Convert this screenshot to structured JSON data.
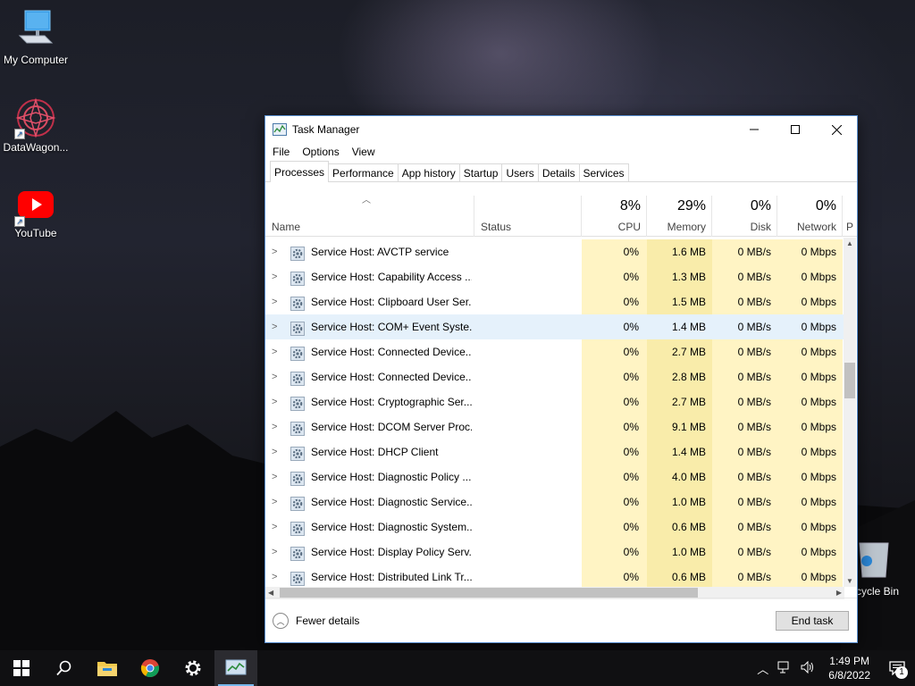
{
  "desktop": {
    "icons": [
      {
        "label": "My Computer"
      },
      {
        "label": "DataWagon..."
      },
      {
        "label": "YouTube"
      },
      {
        "label": "cycle Bin"
      }
    ]
  },
  "window": {
    "title": "Task Manager",
    "menu": [
      "File",
      "Options",
      "View"
    ],
    "tabs": [
      "Processes",
      "Performance",
      "App history",
      "Startup",
      "Users",
      "Details",
      "Services"
    ],
    "columns": {
      "name": "Name",
      "status": "Status",
      "cpu": {
        "pct": "8%",
        "label": "CPU"
      },
      "memory": {
        "pct": "29%",
        "label": "Memory"
      },
      "disk": {
        "pct": "0%",
        "label": "Disk"
      },
      "network": {
        "pct": "0%",
        "label": "Network"
      },
      "power": "P"
    },
    "rows": [
      {
        "name": "Service Host: AVCTP service",
        "cpu": "0%",
        "memory": "1.6 MB",
        "disk": "0 MB/s",
        "network": "0 Mbps"
      },
      {
        "name": "Service Host: Capability Access ...",
        "cpu": "0%",
        "memory": "1.3 MB",
        "disk": "0 MB/s",
        "network": "0 Mbps"
      },
      {
        "name": "Service Host: Clipboard User Ser...",
        "cpu": "0%",
        "memory": "1.5 MB",
        "disk": "0 MB/s",
        "network": "0 Mbps"
      },
      {
        "name": "Service Host: COM+ Event Syste...",
        "cpu": "0%",
        "memory": "1.4 MB",
        "disk": "0 MB/s",
        "network": "0 Mbps"
      },
      {
        "name": "Service Host: Connected Device...",
        "cpu": "0%",
        "memory": "2.7 MB",
        "disk": "0 MB/s",
        "network": "0 Mbps"
      },
      {
        "name": "Service Host: Connected Device...",
        "cpu": "0%",
        "memory": "2.8 MB",
        "disk": "0 MB/s",
        "network": "0 Mbps"
      },
      {
        "name": "Service Host: Cryptographic Ser...",
        "cpu": "0%",
        "memory": "2.7 MB",
        "disk": "0 MB/s",
        "network": "0 Mbps"
      },
      {
        "name": "Service Host: DCOM Server Proc...",
        "cpu": "0%",
        "memory": "9.1 MB",
        "disk": "0 MB/s",
        "network": "0 Mbps"
      },
      {
        "name": "Service Host: DHCP Client",
        "cpu": "0%",
        "memory": "1.4 MB",
        "disk": "0 MB/s",
        "network": "0 Mbps"
      },
      {
        "name": "Service Host: Diagnostic Policy ...",
        "cpu": "0%",
        "memory": "4.0 MB",
        "disk": "0 MB/s",
        "network": "0 Mbps"
      },
      {
        "name": "Service Host: Diagnostic Service...",
        "cpu": "0%",
        "memory": "1.0 MB",
        "disk": "0 MB/s",
        "network": "0 Mbps"
      },
      {
        "name": "Service Host: Diagnostic System...",
        "cpu": "0%",
        "memory": "0.6 MB",
        "disk": "0 MB/s",
        "network": "0 Mbps"
      },
      {
        "name": "Service Host: Display Policy Serv...",
        "cpu": "0%",
        "memory": "1.0 MB",
        "disk": "0 MB/s",
        "network": "0 Mbps"
      },
      {
        "name": "Service Host: Distributed Link Tr...",
        "cpu": "0%",
        "memory": "0.6 MB",
        "disk": "0 MB/s",
        "network": "0 Mbps"
      }
    ],
    "highlighted_row": 3,
    "footer": {
      "fewer_details": "Fewer details",
      "end_task": "End task"
    }
  },
  "taskbar": {
    "clock_time": "1:49 PM",
    "clock_date": "6/8/2022",
    "notification_count": "1"
  },
  "colors": {
    "cpu_fill": "#fff4c4",
    "memory_fill": "#f9ecaa",
    "highlight": "#e5f1fb",
    "accent": "#76b9ed"
  }
}
